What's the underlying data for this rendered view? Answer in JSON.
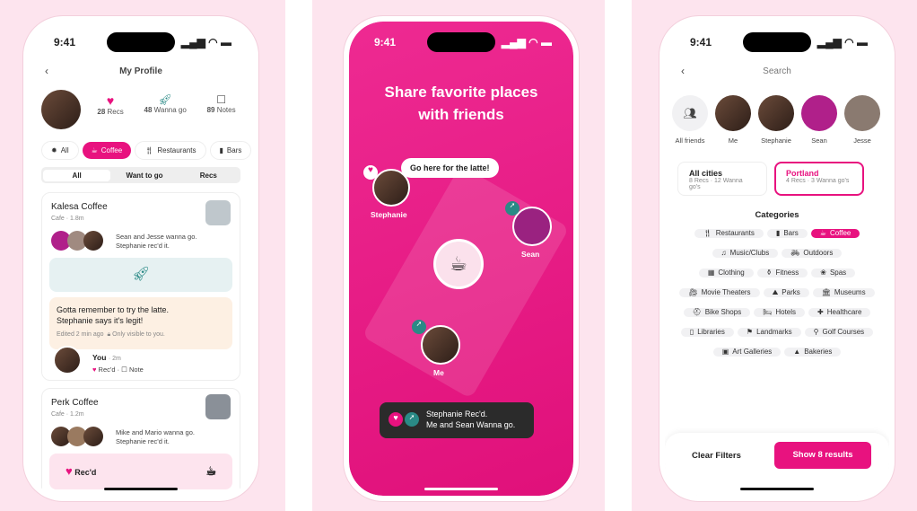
{
  "status": {
    "time": "9:41"
  },
  "profile": {
    "title": "My Profile",
    "stats": [
      {
        "icon": "heart-icon",
        "value": "28",
        "label": "Recs"
      },
      {
        "icon": "rocket-icon",
        "value": "48",
        "label": "Wanna go"
      },
      {
        "icon": "note-icon",
        "value": "89",
        "label": "Notes"
      }
    ],
    "chips": [
      {
        "label": "All",
        "icon": "bug-icon"
      },
      {
        "label": "Coffee",
        "icon": "coffee-icon",
        "selected": true
      },
      {
        "label": "Restaurants",
        "icon": "utensils-icon"
      },
      {
        "label": "Bars",
        "icon": "beer-icon"
      }
    ],
    "segments": [
      "All",
      "Want to go",
      "Recs"
    ],
    "cards": [
      {
        "name": "Kalesa Coffee",
        "sub": "Cafe · 1.8m",
        "friends1": "Sean and Jesse wanna go.",
        "friends2": "Stephanie rec'd it.",
        "note1": "Gotta remember to try the latte.",
        "note2": "Stephanie says it's legit!",
        "edited": "Edited 2 min ago",
        "visibility": "Only visible to you.",
        "you": "You",
        "time": "· 2m",
        "reced": "Rec'd",
        "note": "Note"
      },
      {
        "name": "Perk Coffee",
        "sub": "Cafe · 1.2m",
        "friends1": "Mike and Mario wanna go.",
        "friends2": "Stephanie rec'd it.",
        "reced": "Rec'd"
      }
    ]
  },
  "promo": {
    "headline1": "Share favorite places",
    "headline2": "with friends",
    "bubble": "Go here for the latte!",
    "names": [
      "Stephanie",
      "Sean",
      "Me"
    ],
    "toast1": "Stephanie Rec'd.",
    "toast2": "Me and Sean Wanna go.",
    "accent": "#e8127f"
  },
  "search": {
    "title": "Search",
    "friends": [
      "All friends",
      "Me",
      "Stephanie",
      "Sean",
      "Jesse"
    ],
    "cities": [
      {
        "name": "All cities",
        "sub": "8 Recs · 12 Wanna go's"
      },
      {
        "name": "Portland",
        "sub": "4 Recs · 3 Wanna go's",
        "selected": true
      }
    ],
    "categories_title": "Categories",
    "categories": [
      [
        "Restaurants",
        "Bars",
        "Coffee"
      ],
      [
        "Music/Clubs",
        "Outdoors"
      ],
      [
        "Clothing",
        "Fitness",
        "Spas"
      ],
      [
        "Movie Theaters",
        "Parks",
        "Museums"
      ],
      [
        "Bike Shops",
        "Hotels",
        "Healthcare"
      ],
      [
        "Libraries",
        "Landmarks",
        "Golf Courses"
      ],
      [
        "Art Galleries",
        "Bakeries"
      ]
    ],
    "clear": "Clear Filters",
    "show": "Show 8 results"
  }
}
